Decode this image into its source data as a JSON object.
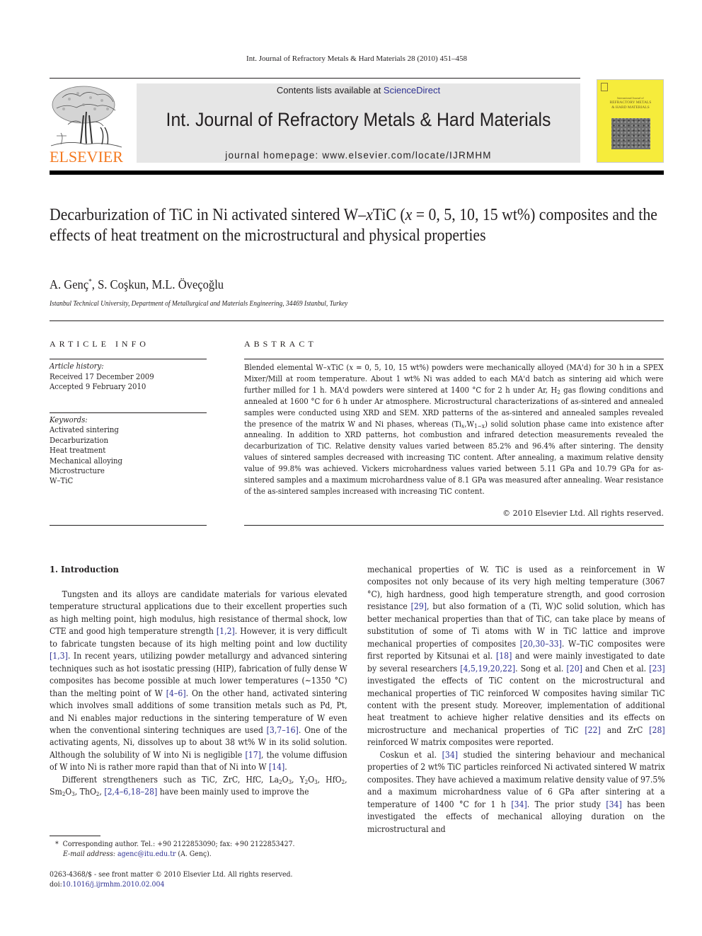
{
  "running_head": "Int. Journal of Refractory Metals & Hard Materials 28 (2010) 451–458",
  "publisher": {
    "logo_word": "ELSEVIER",
    "logo_icon": "elsevier-tree-icon",
    "brand_color": "#f47920"
  },
  "banner": {
    "contents_prefix": "Contents lists available at ",
    "contents_link": "ScienceDirect",
    "journal_title": "Int. Journal of Refractory Metals & Hard Materials",
    "homepage": "journal homepage: www.elsevier.com/locate/IJRMHM",
    "link_color": "#2e3192",
    "background": "#e6e6e6"
  },
  "cover": {
    "title_line1": "International Journal of",
    "title_line2": "REFRACTORY METALS",
    "title_line3": "& HARD MATERIALS",
    "color": "#f6ec3b"
  },
  "article": {
    "title_part1": "Decarburization of TiC in Ni activated sintered W–",
    "title_x": "x",
    "title_part2": "TiC (",
    "title_x2": "x",
    "title_part3": " = 0, 5, 10, 15 wt%) composites and the effects of heat treatment on the microstructural and physical properties",
    "authors_1": "A. Genç",
    "authors_star": "*",
    "authors_2": ", S. Coşkun, M.L. Öveçoğlu",
    "affiliation": "Istanbul Technical University, Department of Metallurgical and Materials Engineering, 34469 Istanbul, Turkey"
  },
  "article_info": {
    "heading": "ARTICLE INFO",
    "history_label": "Article history:",
    "received": "Received 17 December 2009",
    "accepted": "Accepted 9 February 2010",
    "keywords_label": "Keywords:",
    "keywords": [
      "Activated sintering",
      "Decarburization",
      "Heat treatment",
      "Mechanical alloying",
      "Microstructure",
      "W–TiC"
    ]
  },
  "abstract": {
    "heading": "ABSTRACT",
    "p1": "Blended elemental W–",
    "p1x": "x",
    "p2": "TiC (",
    "p2x": "x",
    "p3": " = 0, 5, 10, 15 wt%) powders were mechanically alloyed (MA'd) for 30 h in a SPEX Mixer/Mill at room temperature. About 1 wt% Ni was added to each MA'd batch as sintering aid which were further milled for 1 h. MA'd powders were sintered at 1400 °C for 2 h under Ar, H",
    "p3sub": "2",
    "p4": " gas flowing conditions and annealed at 1600 °C for 6 h under Ar atmosphere. Microstructural characterizations of as-sintered and annealed samples were conducted using XRD and SEM. XRD patterns of the as-sintered and annealed samples revealed the presence of the matrix W and Ni phases, whereas (Ti",
    "p4sub": "x",
    "p5": ",W",
    "p5sub": "1−x",
    "p6": ") solid solution phase came into existence after annealing. In addition to XRD patterns, hot combustion and infrared detection measurements revealed the decarburization of TiC. Relative density values varied between 85.2% and 96.4% after sintering. The density values of sintered samples decreased with increasing TiC content. After annealing, a maximum relative density value of 99.8% was achieved. Vickers microhardness values varied between 5.11 GPa and 10.79 GPa for as-sintered samples and a maximum microhardness value of 8.1 GPa was measured after annealing. Wear resistance of the as-sintered samples increased with increasing TiC content.",
    "copyright": "© 2010 Elsevier Ltd. All rights reserved."
  },
  "intro": {
    "heading": "1. Introduction",
    "left_p1": [
      {
        "t": "Tungsten and its alloys are candidate materials for various elevated temperature structural applications due to their excellent properties such as high melting point, high modulus, high resistance of thermal shock, low CTE and good high temperature strength "
      },
      {
        "r": "[1,2]"
      },
      {
        "t": ". However, it is very difficult to fabricate tungsten because of its high melting point and low ductility "
      },
      {
        "r": "[1,3]"
      },
      {
        "t": ". In recent years, utilizing powder metallurgy and advanced sintering techniques such as hot isostatic pressing (HIP), fabrication of fully dense W composites has become possible at much lower temperatures (∼1350 °C) than the melting point of W "
      },
      {
        "r": "[4–6]"
      },
      {
        "t": ". On the other hand, activated sintering which involves small additions of some transition metals such as Pd, Pt, and Ni enables major reductions in the sintering temperature of W even when the conventional sintering techniques are used "
      },
      {
        "r": "[3,7–16]"
      },
      {
        "t": ". One of the activating agents, Ni, dissolves up to about 38 wt% W in its solid solution. Although the solubility of W into Ni is negligible "
      },
      {
        "r": "[17]"
      },
      {
        "t": ", the volume diffusion of W into Ni is rather more rapid than that of Ni into W "
      },
      {
        "r": "[14]"
      },
      {
        "t": "."
      }
    ],
    "left_p2": [
      {
        "t": "Different strengtheners such as TiC, ZrC, HfC, La"
      },
      {
        "s": "2"
      },
      {
        "t": "O"
      },
      {
        "s": "3"
      },
      {
        "t": ", Y"
      },
      {
        "s": "2"
      },
      {
        "t": "O"
      },
      {
        "s": "3"
      },
      {
        "t": ", HfO"
      },
      {
        "s": "2"
      },
      {
        "t": ", Sm"
      },
      {
        "s": "2"
      },
      {
        "t": "O"
      },
      {
        "s": "3"
      },
      {
        "t": ", ThO"
      },
      {
        "s": "2"
      },
      {
        "t": ", "
      },
      {
        "r": "[2,4–6,18–28]"
      },
      {
        "t": " have been mainly used to improve the"
      }
    ],
    "right_p1": [
      {
        "t": "mechanical properties of W. TiC is used as a reinforcement in W composites not only because of its very high melting temperature (3067 °C), high hardness, good high temperature strength, and good corrosion resistance "
      },
      {
        "r": "[29]"
      },
      {
        "t": ", but also formation of a (Ti, W)C solid solution, which has better mechanical properties than that of TiC, can take place by means of substitution of some of Ti atoms with W in TiC lattice and improve mechanical properties of composites "
      },
      {
        "r": "[20,30–33]"
      },
      {
        "t": ". W–TiC composites were first reported by Kitsunai et al. "
      },
      {
        "r": "[18]"
      },
      {
        "t": " and were mainly investigated to date by several researchers "
      },
      {
        "r": "[4,5,19,20,22]"
      },
      {
        "t": ". Song et al. "
      },
      {
        "r": "[20]"
      },
      {
        "t": " and Chen et al. "
      },
      {
        "r": "[23]"
      },
      {
        "t": " investigated the effects of TiC content on the microstructural and mechanical properties of TiC reinforced W composites having similar TiC content with the present study. Moreover, implementation of additional heat treatment to achieve higher relative densities and its effects on microstructure and mechanical properties of TiC "
      },
      {
        "r": "[22]"
      },
      {
        "t": " and ZrC "
      },
      {
        "r": "[28]"
      },
      {
        "t": " reinforced W matrix composites were reported."
      }
    ],
    "right_p2": [
      {
        "t": "Coskun et al. "
      },
      {
        "r": "[34]"
      },
      {
        "t": " studied the sintering behaviour and mechanical properties of 2 wt% TiC particles reinforced Ni activated sintered W matrix composites. They have achieved a maximum relative density value of 97.5% and a maximum microhardness value of 6 GPa after sintering at a temperature of 1400 °C for 1 h "
      },
      {
        "r": "[34]"
      },
      {
        "t": ". The prior study "
      },
      {
        "r": "[34]"
      },
      {
        "t": " has been investigated the effects of mechanical alloying duration on the microstructural and"
      }
    ]
  },
  "footnote": {
    "star": "*",
    "corresponding": "Corresponding author. Tel.: +90 2122853090; fax: +90 2122853427.",
    "email_label": "E-mail address:",
    "email": "agenc@itu.edu.tr",
    "email_suffix": " (A. Genç)."
  },
  "front_matter": {
    "issn_line": "0263-4368/$ - see front matter © 2010 Elsevier Ltd. All rights reserved.",
    "doi_label": "doi:",
    "doi": "10.1016/j.ijrmhm.2010.02.004"
  }
}
